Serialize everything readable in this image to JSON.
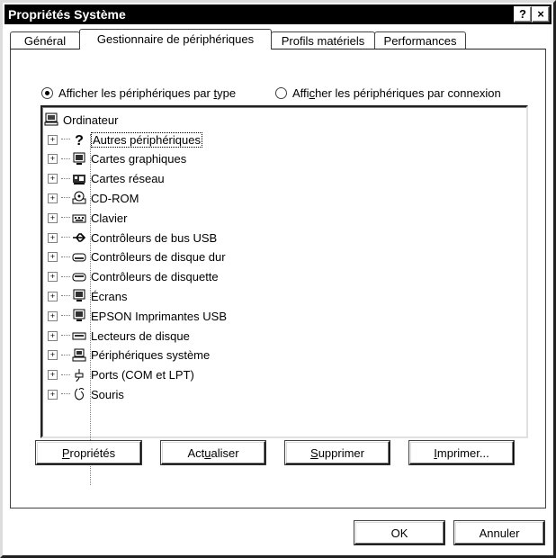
{
  "window": {
    "title": "Propriétés Système",
    "help_label": "?",
    "close_label": "×"
  },
  "tabs": [
    {
      "label": "Général"
    },
    {
      "label": "Gestionnaire de périphériques"
    },
    {
      "label": "Profils matériels"
    },
    {
      "label": "Performances"
    }
  ],
  "view": {
    "by_type": {
      "pre": "Afficher les périphériques par ",
      "u": "t",
      "post": "ype",
      "checked": true
    },
    "by_connection": {
      "pre": "Affi",
      "u": "c",
      "post": "her les périphériques par connexion",
      "checked": false
    }
  },
  "tree": {
    "root": "Ordinateur",
    "items": [
      {
        "label": "Autres périphériques",
        "icon": "question-icon"
      },
      {
        "label": "Cartes graphiques",
        "icon": "monitor-icon"
      },
      {
        "label": "Cartes réseau",
        "icon": "network-card-icon"
      },
      {
        "label": "CD-ROM",
        "icon": "cdrom-icon"
      },
      {
        "label": "Clavier",
        "icon": "keyboard-icon"
      },
      {
        "label": "Contrôleurs de bus USB",
        "icon": "usb-icon"
      },
      {
        "label": "Contrôleurs de disque dur",
        "icon": "harddisk-icon"
      },
      {
        "label": "Contrôleurs de disquette",
        "icon": "floppy-controller-icon"
      },
      {
        "label": "Écrans",
        "icon": "monitor-icon"
      },
      {
        "label": "EPSON Imprimantes USB",
        "icon": "monitor-icon"
      },
      {
        "label": "Lecteurs de disque",
        "icon": "disk-drive-icon"
      },
      {
        "label": "Périphériques système",
        "icon": "computer-icon"
      },
      {
        "label": "Ports (COM et LPT)",
        "icon": "port-icon"
      },
      {
        "label": "Souris",
        "icon": "mouse-icon"
      }
    ]
  },
  "actions": {
    "properties": {
      "u": "P",
      "rest": "ropriétés"
    },
    "refresh": {
      "pre": "Act",
      "u": "u",
      "post": "aliser"
    },
    "remove": {
      "u": "S",
      "rest": "upprimer"
    },
    "print": {
      "u": "I",
      "rest": "mprimer..."
    }
  },
  "footer": {
    "ok_label": "OK",
    "cancel_label": "Annuler"
  }
}
